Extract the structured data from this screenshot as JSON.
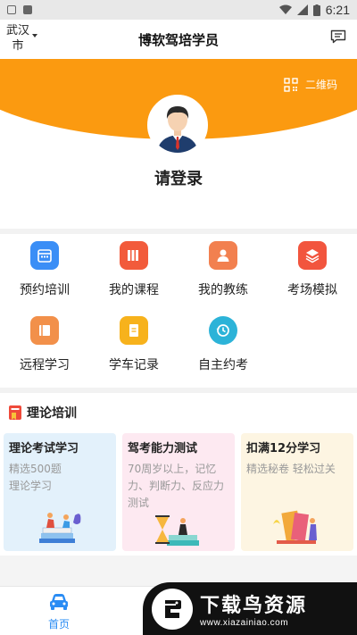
{
  "status_bar": {
    "time": "6:21",
    "icons": [
      "wifi-icon",
      "signal-icon",
      "battery-icon"
    ]
  },
  "nav": {
    "city": "武汉市",
    "title": "博软驾培学员",
    "message_icon": "message-icon"
  },
  "header": {
    "qr_label": "二维码",
    "login_text": "请登录",
    "accent": "#fb9a10"
  },
  "functions": [
    {
      "label": "预约培训",
      "icon": "calendar-icon",
      "color": "#3a8ef6"
    },
    {
      "label": "我的课程",
      "icon": "books-icon",
      "color": "#f25b3b"
    },
    {
      "label": "我的教练",
      "icon": "person-icon",
      "color": "#f2804f"
    },
    {
      "label": "考场模拟",
      "icon": "layers-icon",
      "color": "#f2553e"
    },
    {
      "label": "远程学习",
      "icon": "book-icon",
      "color": "#f2904a"
    },
    {
      "label": "学车记录",
      "icon": "notepad-icon",
      "color": "#f7b21c"
    },
    {
      "label": "自主约考",
      "icon": "history-icon",
      "color": "#2cb3d8"
    }
  ],
  "theory": {
    "title": "理论培训",
    "cards": [
      {
        "title": "理论考试学习",
        "desc": "精选500题\n理论学习",
        "bg": "#e3f1fb"
      },
      {
        "title": "驾考能力测试",
        "desc": "70周岁以上，记忆力、判断力、反应力测试",
        "bg": "#fde9f1"
      },
      {
        "title": "扣满12分学习",
        "desc": "精选秘卷 轻松过关",
        "bg": "#fdf5e2"
      }
    ]
  },
  "tabbar": {
    "home_label": "首页",
    "home_color": "#2a8cf4"
  },
  "watermark": {
    "title": "下载鸟资源",
    "url": "www.xiazainiao.com"
  }
}
